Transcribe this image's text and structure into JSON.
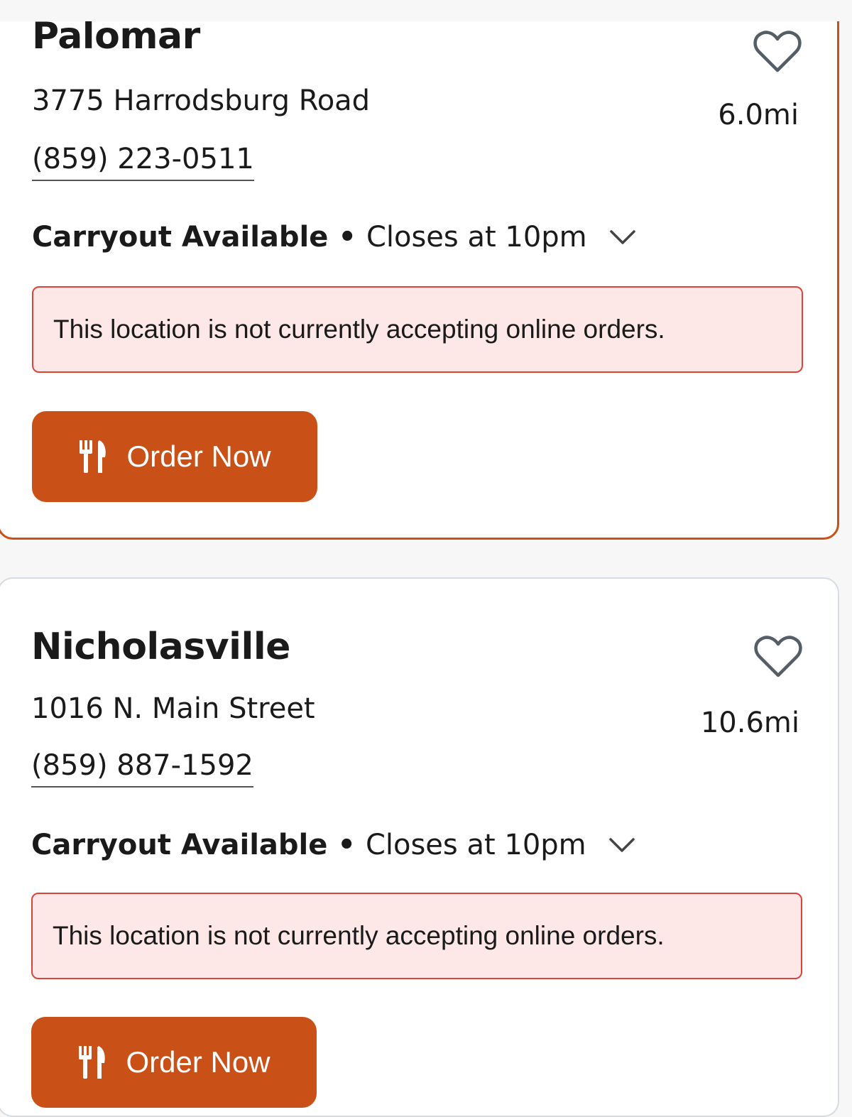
{
  "locations": [
    {
      "name": "Palomar",
      "address": "3775 Harrodsburg Road",
      "phone": "(859) 223-0511",
      "distance": "6.0mi",
      "status_strong": "Carryout Available",
      "separator": "•",
      "hours": "Closes at 10pm",
      "notice": "This location is not currently accepting online orders.",
      "order_label": "Order Now",
      "selected": true
    },
    {
      "name": "Nicholasville",
      "address": "1016 N. Main Street",
      "phone": "(859) 887-1592",
      "distance": "10.6mi",
      "status_strong": "Carryout Available",
      "separator": "•",
      "hours": "Closes at 10pm",
      "notice": "This location is not currently accepting online orders.",
      "order_label": "Order Now",
      "selected": false
    }
  ],
  "icons": {
    "favorite": "heart-icon",
    "expand": "chevron-down-icon",
    "order": "utensils-icon"
  },
  "colors": {
    "accent": "#c95016",
    "notice_bg": "#fde8e7",
    "notice_border": "#d9443a",
    "card_border": "#d6dce2",
    "text": "#1a1a1a"
  }
}
